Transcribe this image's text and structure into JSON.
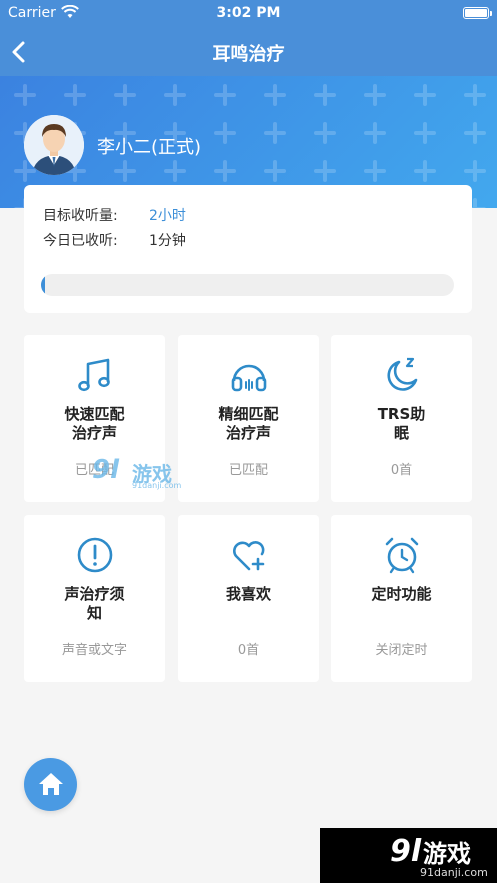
{
  "status_bar": {
    "carrier": "Carrier",
    "time": "3:02 PM"
  },
  "nav": {
    "title": "耳鸣治疗"
  },
  "profile": {
    "name": "李小二(正式)"
  },
  "stats": {
    "goal_label": "目标收听量:",
    "goal_value": "2小时",
    "today_label": "今日已收听:",
    "today_value": "1分钟",
    "progress_fraction": 0.01
  },
  "tiles": [
    {
      "label": "快速匹配治疗声",
      "sub": "已匹配",
      "icon": "music-note-icon"
    },
    {
      "label": "精细匹配治疗声",
      "sub": "已匹配",
      "icon": "headphones-icon"
    },
    {
      "label": "TRS助眠",
      "sub": "0首",
      "icon": "moon-sleep-icon"
    },
    {
      "label": "声治疗须知",
      "sub": "声音或文字",
      "icon": "exclamation-circle-icon"
    },
    {
      "label": "我喜欢",
      "sub": "0首",
      "icon": "heart-plus-icon"
    },
    {
      "label": "定时功能",
      "sub": "关闭定时",
      "icon": "alarm-clock-icon"
    }
  ],
  "watermark": {
    "mark": "9l",
    "brand": "游戏",
    "domain": "91danji.com"
  },
  "colors": {
    "primary": "#4a8fd9",
    "accent_blue": "#3d8fd8",
    "icon_blue": "#2e8bc9",
    "page_bg": "#f5f5f5"
  }
}
